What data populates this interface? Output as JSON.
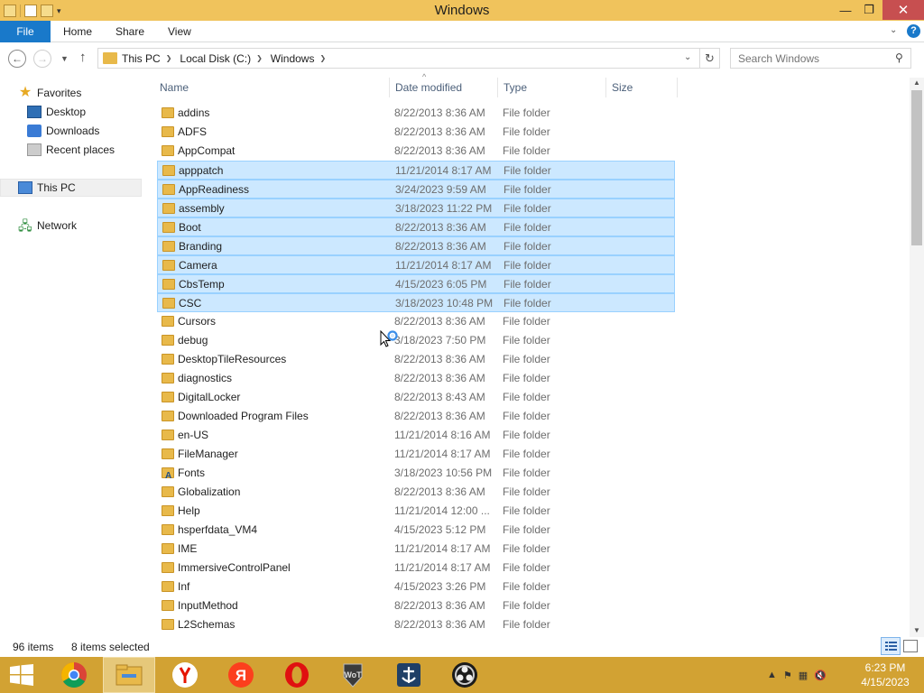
{
  "window": {
    "title": "Windows"
  },
  "ribbon": {
    "tabs": [
      "File",
      "Home",
      "Share",
      "View"
    ]
  },
  "address": {
    "crumbs": [
      "This PC",
      "Local Disk (C:)",
      "Windows"
    ],
    "search_placeholder": "Search Windows"
  },
  "nav": {
    "favorites": "Favorites",
    "desktop": "Desktop",
    "downloads": "Downloads",
    "recent": "Recent places",
    "this_pc": "This PC",
    "network": "Network"
  },
  "columns": {
    "name": "Name",
    "date": "Date modified",
    "type": "Type",
    "size": "Size"
  },
  "files": [
    {
      "name": "addins",
      "date": "8/22/2013 8:36 AM",
      "type": "File folder",
      "selected": false
    },
    {
      "name": "ADFS",
      "date": "8/22/2013 8:36 AM",
      "type": "File folder",
      "selected": false
    },
    {
      "name": "AppCompat",
      "date": "8/22/2013 8:36 AM",
      "type": "File folder",
      "selected": false
    },
    {
      "name": "apppatch",
      "date": "11/21/2014 8:17 AM",
      "type": "File folder",
      "selected": true
    },
    {
      "name": "AppReadiness",
      "date": "3/24/2023 9:59 AM",
      "type": "File folder",
      "selected": true
    },
    {
      "name": "assembly",
      "date": "3/18/2023 11:22 PM",
      "type": "File folder",
      "selected": true
    },
    {
      "name": "Boot",
      "date": "8/22/2013 8:36 AM",
      "type": "File folder",
      "selected": true
    },
    {
      "name": "Branding",
      "date": "8/22/2013 8:36 AM",
      "type": "File folder",
      "selected": true
    },
    {
      "name": "Camera",
      "date": "11/21/2014 8:17 AM",
      "type": "File folder",
      "selected": true
    },
    {
      "name": "CbsTemp",
      "date": "4/15/2023 6:05 PM",
      "type": "File folder",
      "selected": true
    },
    {
      "name": "CSC",
      "date": "3/18/2023 10:48 PM",
      "type": "File folder",
      "selected": true
    },
    {
      "name": "Cursors",
      "date": "8/22/2013 8:36 AM",
      "type": "File folder",
      "selected": false
    },
    {
      "name": "debug",
      "date": "3/18/2023 7:50 PM",
      "type": "File folder",
      "selected": false
    },
    {
      "name": "DesktopTileResources",
      "date": "8/22/2013 8:36 AM",
      "type": "File folder",
      "selected": false
    },
    {
      "name": "diagnostics",
      "date": "8/22/2013 8:36 AM",
      "type": "File folder",
      "selected": false
    },
    {
      "name": "DigitalLocker",
      "date": "8/22/2013 8:43 AM",
      "type": "File folder",
      "selected": false
    },
    {
      "name": "Downloaded Program Files",
      "date": "8/22/2013 8:36 AM",
      "type": "File folder",
      "selected": false
    },
    {
      "name": "en-US",
      "date": "11/21/2014 8:16 AM",
      "type": "File folder",
      "selected": false
    },
    {
      "name": "FileManager",
      "date": "11/21/2014 8:17 AM",
      "type": "File folder",
      "selected": false
    },
    {
      "name": "Fonts",
      "date": "3/18/2023 10:56 PM",
      "type": "File folder",
      "selected": false,
      "icon": "fonts-folder-icon"
    },
    {
      "name": "Globalization",
      "date": "8/22/2013 8:36 AM",
      "type": "File folder",
      "selected": false
    },
    {
      "name": "Help",
      "date": "11/21/2014 12:00 ...",
      "type": "File folder",
      "selected": false
    },
    {
      "name": "hsperfdata_VM4",
      "date": "4/15/2023 5:12 PM",
      "type": "File folder",
      "selected": false
    },
    {
      "name": "IME",
      "date": "11/21/2014 8:17 AM",
      "type": "File folder",
      "selected": false
    },
    {
      "name": "ImmersiveControlPanel",
      "date": "11/21/2014 8:17 AM",
      "type": "File folder",
      "selected": false
    },
    {
      "name": "Inf",
      "date": "4/15/2023 3:26 PM",
      "type": "File folder",
      "selected": false
    },
    {
      "name": "InputMethod",
      "date": "8/22/2013 8:36 AM",
      "type": "File folder",
      "selected": false
    },
    {
      "name": "L2Schemas",
      "date": "8/22/2013 8:36 AM",
      "type": "File folder",
      "selected": false
    }
  ],
  "status": {
    "count": "96 items",
    "selected": "8 items selected"
  },
  "taskbar": {
    "clock_time": "6:23 PM",
    "clock_date": "4/15/2023",
    "apps": [
      "windows-logo-icon",
      "chrome-icon",
      "file-explorer-icon",
      "yandex-browser-icon",
      "yandex-icon",
      "opera-icon",
      "world-of-tanks-icon",
      "world-of-warships-icon",
      "obs-icon"
    ]
  },
  "colors": {
    "title_bar": "#f0c35c",
    "taskbar": "#d2a233",
    "selection": "#cce8ff",
    "selection_border": "#99d1ff",
    "file_tab": "#1979ca",
    "close_button": "#c74f50"
  }
}
